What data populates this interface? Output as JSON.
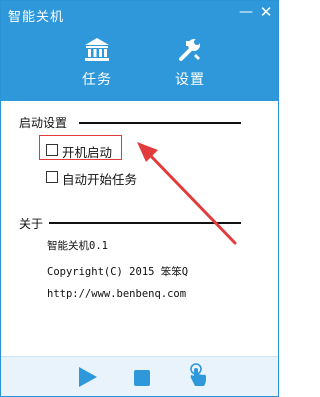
{
  "window": {
    "title": "智能关机",
    "minimize_glyph": "—",
    "close_glyph": "✕"
  },
  "tabs": [
    {
      "label": "任务",
      "icon": "bank-icon"
    },
    {
      "label": "设置",
      "icon": "wrench-icon"
    }
  ],
  "startup": {
    "title": "启动设置",
    "options": [
      {
        "label": "开机启动",
        "checked": false,
        "highlighted": true
      },
      {
        "label": "自动开始任务",
        "checked": false,
        "highlighted": false
      }
    ]
  },
  "about": {
    "title": "关于",
    "lines": [
      "智能关机0.1",
      "Copyright(C) 2015 笨笨Q",
      "http://www.benbenq.com"
    ]
  },
  "footer": {
    "buttons": [
      {
        "icon": "play-icon"
      },
      {
        "icon": "stop-icon"
      },
      {
        "icon": "tap-icon"
      }
    ]
  },
  "colors": {
    "header": "#2e98da",
    "footer": "#e8f3fc",
    "accent": "#2e98da",
    "highlight": "#e23b3b"
  }
}
